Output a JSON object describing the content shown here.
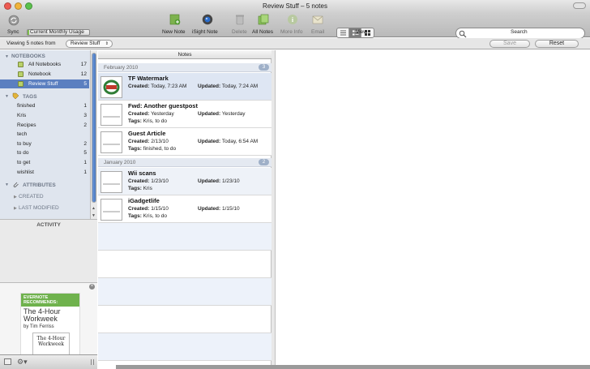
{
  "window": {
    "title": "Review Stuff – 5 notes"
  },
  "toolbar": {
    "sync_label": "Sync",
    "usage_label": "Current Monthly Usage",
    "usage_fraction": 0.03,
    "new_note_label": "New Note",
    "isight_label": "iSight Note",
    "delete_label": "Delete",
    "all_notes_label": "All Notes",
    "more_info_label": "More Info",
    "email_label": "Email",
    "view_label": "View",
    "search_label": "Search",
    "search_placeholder": ""
  },
  "filterbar": {
    "viewing_text": "Viewing 5 notes from",
    "notebook_dropdown": "Review Stuff",
    "save_label": "Save",
    "reset_label": "Reset"
  },
  "sidebar": {
    "notebooks_header": "NOTEBOOKS",
    "notebooks": [
      {
        "label": "All Notebooks",
        "count": "17"
      },
      {
        "label": "Notebook",
        "count": "12"
      },
      {
        "label": "Review Stuff",
        "count": "5"
      }
    ],
    "tags_header": "TAGS",
    "tags": [
      {
        "label": "finished",
        "count": "1"
      },
      {
        "label": "Kris",
        "count": "3"
      },
      {
        "label": "Recipes",
        "count": "2"
      },
      {
        "label": "tech",
        "count": ""
      },
      {
        "label": "to buy",
        "count": "2"
      },
      {
        "label": "to do",
        "count": "5"
      },
      {
        "label": "to get",
        "count": "1"
      },
      {
        "label": "wishlist",
        "count": "1"
      }
    ],
    "attributes_header": "ATTRIBUTES",
    "created_label": "CREATED",
    "last_modified_label": "LAST MODIFIED",
    "activity_header": "ACTIVITY"
  },
  "promo": {
    "badge_line1": "EVERNOTE",
    "badge_line2": "RECOMMENDS:",
    "title_line1": "The 4-Hour",
    "title_line2": "Workweek",
    "author": "by Tim Ferriss",
    "cover_line1": "The 4-Hour",
    "cover_line2": "Workweek"
  },
  "notes": {
    "column_header": "Notes",
    "groups": [
      {
        "label": "February 2010",
        "count": "3"
      },
      {
        "label": "January 2010",
        "count": "2"
      }
    ],
    "items": [
      {
        "title": "TF Watermark",
        "created": "Today, 7:23 AM",
        "updated": "Today, 7:24 AM",
        "tags": ""
      },
      {
        "title": "Fwd: Another guestpost",
        "created": "Yesterday",
        "updated": "Yesterday",
        "tags": "Kris, to do"
      },
      {
        "title": "Guest Article",
        "created": "2/13/10",
        "updated": "Today, 6:54 AM",
        "tags": "finished, to do"
      },
      {
        "title": "Wii scans",
        "created": "1/23/10",
        "updated": "1/23/10",
        "tags": "Kris"
      },
      {
        "title": "iGadgetlife",
        "created": "1/15/10",
        "updated": "1/15/10",
        "tags": "Kris, to do"
      }
    ],
    "created_prefix": "Created:",
    "updated_prefix": "Updated:",
    "tags_prefix": "Tags:"
  },
  "colors": {
    "selection": "#5b7fc0",
    "sidebar_bg": "#dfe5ee",
    "accent_green": "#6fb24d"
  }
}
